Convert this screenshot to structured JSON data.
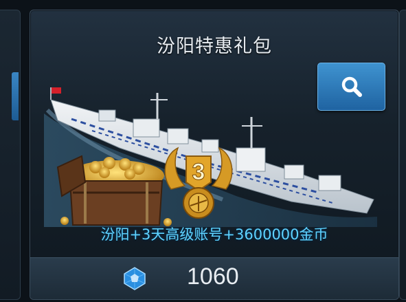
{
  "pack": {
    "title": "汾阳特惠礼包",
    "description": "汾阳+3天高级账号+3600000金币",
    "price": "1060",
    "badge_rank": "3",
    "search_icon": "magnifier-icon",
    "currency_icon": "gem-icon",
    "ship_flag_color": "#d4202a"
  },
  "colors": {
    "description_text": "#5fd3ff",
    "button": "#2f7fbf",
    "badge_gold": "#e2a52a"
  }
}
